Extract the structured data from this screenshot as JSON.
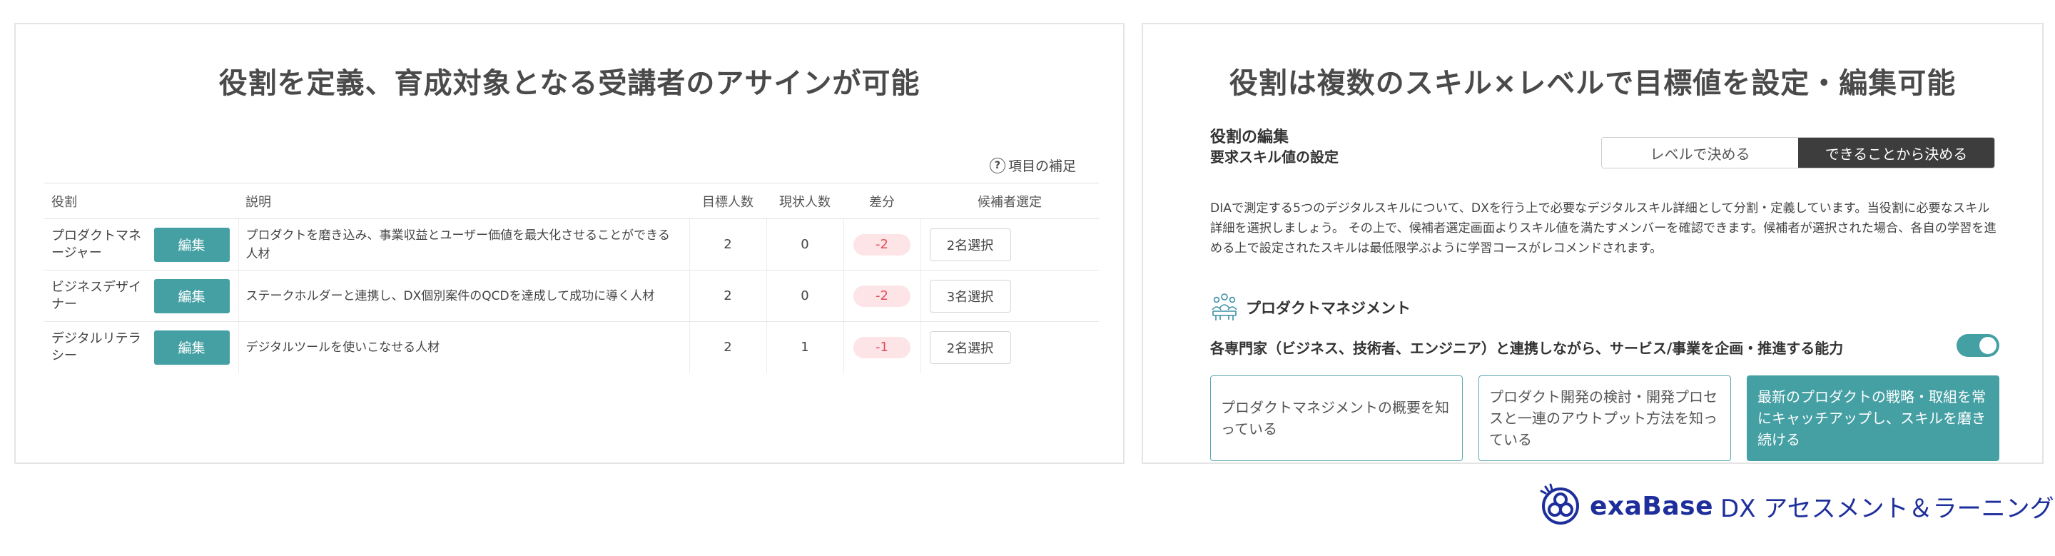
{
  "left": {
    "title": "役割を定義、育成対象となる受講者のアサインが可能",
    "supplement": "項目の補足",
    "supplement_icon": "?",
    "columns": [
      "役割",
      "説明",
      "目標人数",
      "現状人数",
      "差分",
      "候補者選定"
    ],
    "rows": [
      {
        "role": "プロダクトマネージャー",
        "edit": "編集",
        "desc": "プロダクトを磨き込み、事業収益とユーザー価値を最大化させることができる人材",
        "target": "2",
        "current": "0",
        "diff": "-2",
        "select": "2名選択"
      },
      {
        "role": "ビジネスデザイナー",
        "edit": "編集",
        "desc": "ステークホルダーと連携し、DX個別案件のQCDを達成して成功に導く人材",
        "target": "2",
        "current": "0",
        "diff": "-2",
        "select": "3名選択"
      },
      {
        "role": "デジタルリテラシー",
        "edit": "編集",
        "desc": "デジタルツールを使いこなせる人材",
        "target": "2",
        "current": "1",
        "diff": "-1",
        "select": "2名選択"
      }
    ]
  },
  "right": {
    "title": "役割は複数のスキル×レベルで目標値を設定・編集可能",
    "edit_title": "役割の編集",
    "edit_subtitle": "要求スキル値の設定",
    "segment": {
      "option_level": "レベルで決める",
      "option_can": "できることから決める",
      "active": "option_can"
    },
    "paragraph": "DIAで測定する5つのデジタルスキルについて、DXを行う上で必要なデジタルスキル詳細として分割・定義しています。当役割に必要なスキル詳細を選択しましょう。 その上で、候補者選定画面よりスキル値を満たすメンバーを確認できます。候補者が選択された場合、各自の学習を進める上で設定されたスキルは最低限学ぶように学習コースがレコメンドされます。",
    "section_title": "プロダクトマネジメント",
    "ability": "各専門家（ビジネス、技術者、エンジニア）と連携しながら、サービス/事業を企画・推進する能力",
    "toggle_on": true,
    "cards": [
      {
        "text": "プロダクトマネジメントの概要を知っている",
        "selected": false
      },
      {
        "text": "プロダクト開発の検討・開発プロセスと一連のアウトプット方法を知っている",
        "selected": false
      },
      {
        "text": "最新のプロダクトの戦略・取組を常にキャッチアップし、スキルを磨き続ける",
        "selected": true
      }
    ]
  },
  "footer": {
    "brand": "exaBase",
    "product": "DX アセスメント＆ラーニング",
    "logo_icon": "exabase-logo-icon"
  },
  "colors": {
    "accent": "#45a0a4",
    "diff_bg": "#fde4e6",
    "diff_text": "#e04e5a",
    "brand_blue": "#1e2f9c",
    "segment_active": "#3d3d3d"
  }
}
